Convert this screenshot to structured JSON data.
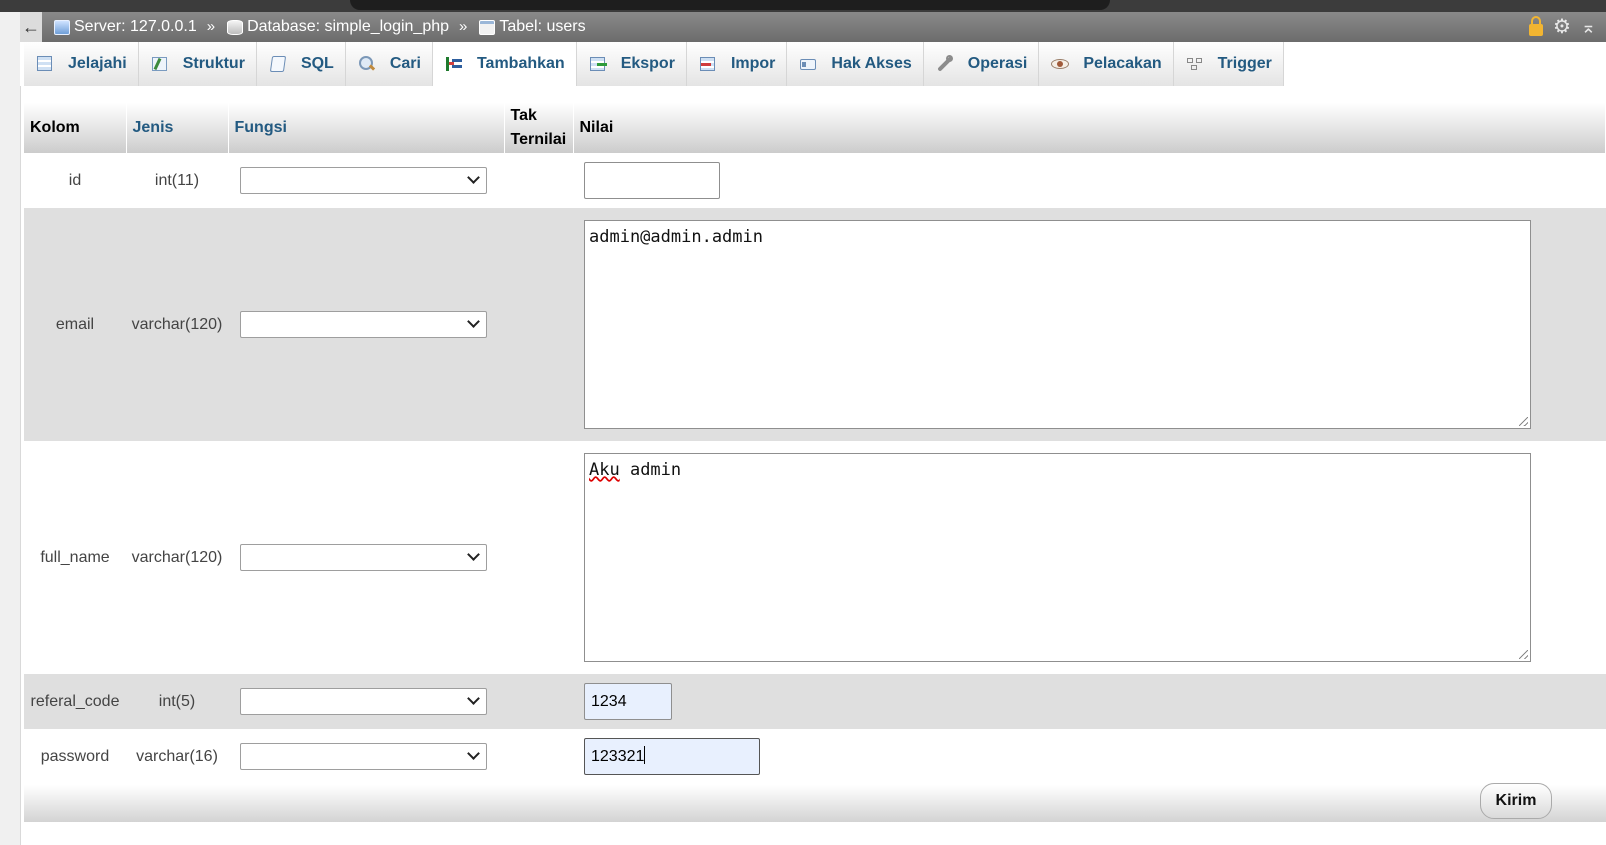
{
  "breadcrumb": {
    "back_glyph": "←",
    "server": "Server: 127.0.0.1",
    "database": "Database: simple_login_php",
    "table": "Tabel: users",
    "separator": "»"
  },
  "tabs": [
    {
      "label": "Jelajahi",
      "icon": "browse-icon"
    },
    {
      "label": "Struktur",
      "icon": "structure-icon"
    },
    {
      "label": "SQL",
      "icon": "sql-icon"
    },
    {
      "label": "Cari",
      "icon": "search-icon"
    },
    {
      "label": "Tambahkan",
      "icon": "insert-icon",
      "active": true
    },
    {
      "label": "Ekspor",
      "icon": "export-icon"
    },
    {
      "label": "Impor",
      "icon": "import-icon"
    },
    {
      "label": "Hak Akses",
      "icon": "privileges-icon"
    },
    {
      "label": "Operasi",
      "icon": "operations-icon"
    },
    {
      "label": "Pelacakan",
      "icon": "tracking-icon"
    },
    {
      "label": "Trigger",
      "icon": "trigger-icon"
    }
  ],
  "table_header": {
    "kolom": "Kolom",
    "jenis": "Jenis",
    "fungsi": "Fungsi",
    "tak": "Tak",
    "ternilai": "Ternilai",
    "nilai": "Nilai"
  },
  "rows": [
    {
      "name": "id",
      "type": "int(11)",
      "value": ""
    },
    {
      "name": "email",
      "type": "varchar(120)",
      "value": "admin@admin.admin"
    },
    {
      "name": "full_name",
      "type": "varchar(120)",
      "value_word1": "Aku",
      "value_rest": " admin"
    },
    {
      "name": "referal_code",
      "type": "int(5)",
      "value": "1234"
    },
    {
      "name": "password",
      "type": "varchar(16)",
      "value": "123321"
    }
  ],
  "submit_label": "Kirim",
  "colors": {
    "tab_text": "#235a81",
    "breadcrumb_bg": "#6c6c6c",
    "autofill_bg": "#e8f0fe"
  }
}
